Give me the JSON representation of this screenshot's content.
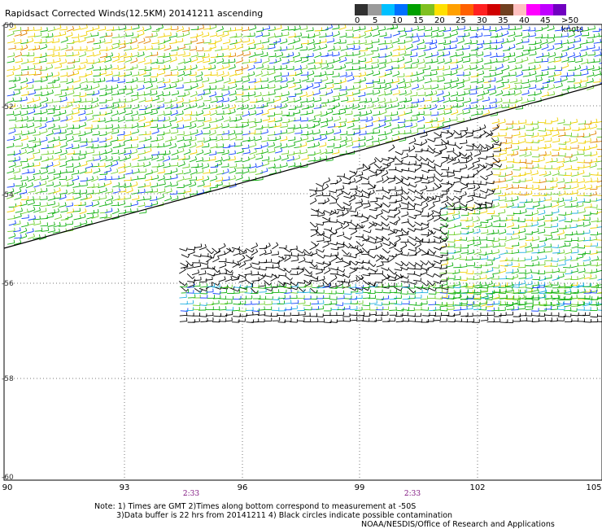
{
  "title": "Rapidsact Corrected Winds(12.5KM) 20141211 ascending",
  "colorbar": {
    "colors": [
      "#303030",
      "#9a9a9a",
      "#00c0ff",
      "#0070ff",
      "#00a000",
      "#80c020",
      "#ffe000",
      "#ffa000",
      "#ff6000",
      "#ff2020",
      "#d00000",
      "#704020",
      "#ffc0c0",
      "#ff00ff",
      "#c000ff",
      "#7000c0"
    ],
    "labels": [
      "0",
      "5",
      "10",
      "15",
      "20",
      "25",
      "30",
      "35",
      "40",
      "45",
      ">50 knots"
    ]
  },
  "lat_labels": [
    "-50",
    "-52",
    "-54",
    "-56",
    "-58",
    "-60"
  ],
  "lon_labels": [
    "90",
    "93",
    "96",
    "99",
    "102",
    "105"
  ],
  "time_labels": [
    "2:33",
    "2:33"
  ],
  "notes": {
    "line1": "Note: 1) Times are GMT 2)Times along bottom correspond to measurement at -50S",
    "line2": "3)Data buffer is 22 hrs from 20141211 4) Black circles indicate possible contamination",
    "line3": "NOAA/NESDIS/Office of Research and Applications"
  },
  "wind_colors": {
    "black": "#000000",
    "blue": "#1040ff",
    "green": "#10b010",
    "lightgreen": "#70d030",
    "yellow": "#f0d000",
    "orange": "#e08000",
    "cyan": "#20b0e0"
  }
}
